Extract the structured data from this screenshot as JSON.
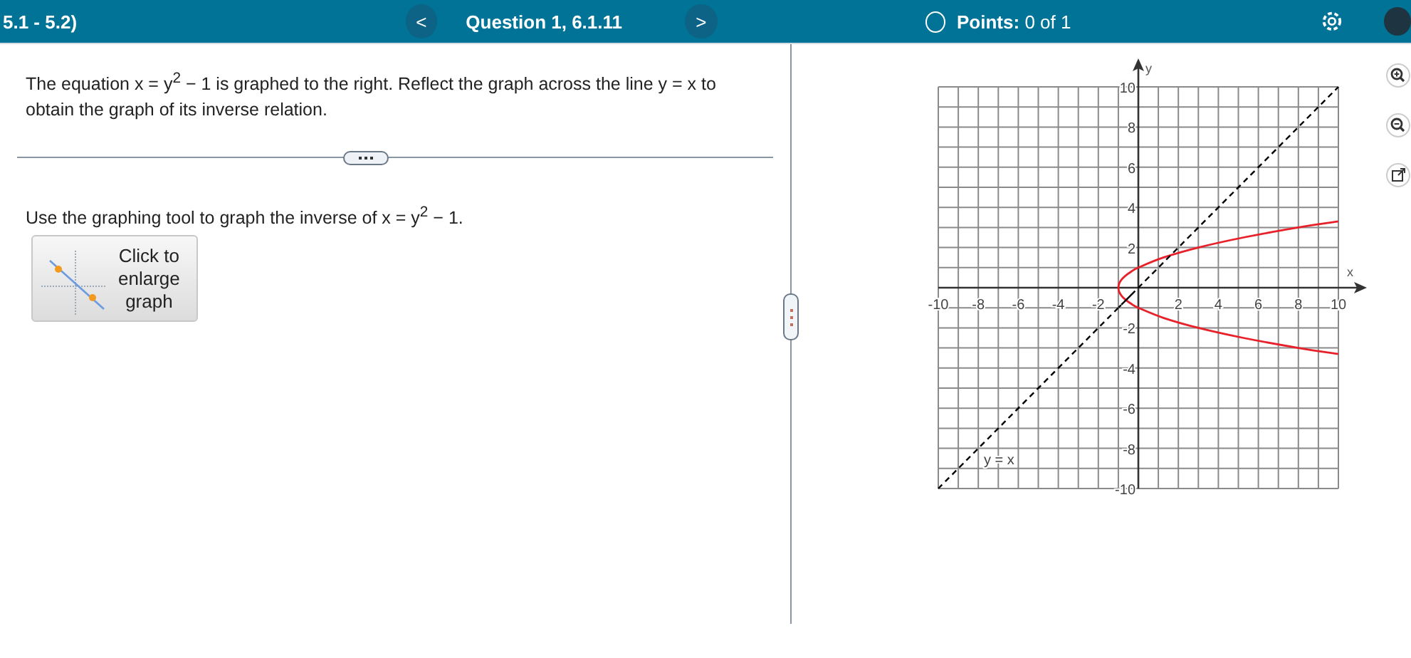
{
  "header": {
    "title": "5.1 - 5.2)",
    "prev_label": "<",
    "question": "Question 1, 6.1.11",
    "next_label": ">",
    "points": "**Points:** 0 of 1"
  },
  "question": {
    "prompt": "The equation x = y$^{2}$ − 1 is graphed to the right. Reflect the graph across the line y = x to obtain the graph of its inverse relation.",
    "instruction": "Use the graphing tool to graph the inverse of  x = y$^{2}$ − 1.",
    "enlarge_button": [
      "Click to",
      "enlarge",
      "graph"
    ]
  },
  "graph": {
    "chart_data": {
      "type": "line",
      "xlabel": "x",
      "ylabel": "y",
      "xlim": [
        -10,
        10
      ],
      "ylim": [
        -10,
        10
      ],
      "xticks": [
        {
          "value": -10,
          "label": "-10"
        },
        {
          "value": -8,
          "label": "-8"
        },
        {
          "value": -6,
          "label": "-6"
        },
        {
          "value": -4,
          "label": "-4"
        },
        {
          "value": -2,
          "label": "-2"
        },
        {
          "value": 2,
          "label": "2"
        },
        {
          "value": 4,
          "label": "4"
        },
        {
          "value": 6,
          "label": "6"
        },
        {
          "value": 8,
          "label": "8"
        },
        {
          "value": 10,
          "label": "10"
        }
      ],
      "yticks": [
        {
          "value": -10,
          "label": "-10"
        },
        {
          "value": -8,
          "label": "-8"
        },
        {
          "value": -6,
          "label": "-6"
        },
        {
          "value": -4,
          "label": "-4"
        },
        {
          "value": -2,
          "label": "-2"
        },
        {
          "value": 2,
          "label": "2"
        },
        {
          "value": 4,
          "label": "4"
        },
        {
          "value": 6,
          "label": "6"
        },
        {
          "value": 8,
          "label": "8"
        },
        {
          "value": 10,
          "label": "10"
        }
      ],
      "grid": true,
      "x": [
        -10,
        -1,
        -0.96,
        -0.84,
        -0.64,
        -0.36,
        0,
        1.25,
        3,
        5.25,
        8,
        10
      ],
      "series": [
        {
          "color": "#e8202a",
          "line_style": "solid",
          "values": [
            null,
            0,
            0.2,
            0.4,
            0.6,
            0.8,
            1,
            1.5,
            2,
            2.5,
            3,
            3.3
          ]
        },
        {
          "color": "#e8202a",
          "line_style": "solid",
          "values": [
            null,
            0,
            -0.2,
            -0.4,
            -0.6,
            -0.8,
            -1,
            -1.5,
            -2,
            -2.5,
            -3,
            -3.3
          ]
        },
        {
          "name": "y = x",
          "color": "#000000",
          "line_style": "dashed",
          "values": [
            -10,
            -1,
            -0.96,
            -0.84,
            -0.64,
            -0.36,
            0,
            1.25,
            3,
            5.25,
            8,
            10
          ]
        }
      ]
    }
  }
}
